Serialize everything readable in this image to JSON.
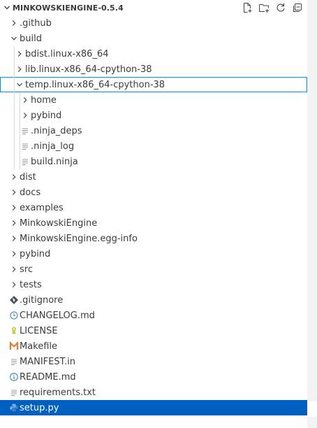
{
  "header": {
    "title": "MINKOWSKIENGINE-0.5.4",
    "actions": [
      {
        "name": "new-file-icon"
      },
      {
        "name": "new-folder-icon"
      },
      {
        "name": "refresh-icon"
      },
      {
        "name": "collapse-all-icon"
      }
    ]
  },
  "tree": [
    {
      "label": ".github",
      "depth": 0,
      "kind": "folder",
      "expanded": false
    },
    {
      "label": "build",
      "depth": 0,
      "kind": "folder",
      "expanded": true
    },
    {
      "label": "bdist.linux-x86_64",
      "depth": 1,
      "kind": "folder",
      "expanded": false
    },
    {
      "label": "lib.linux-x86_64-cpython-38",
      "depth": 1,
      "kind": "folder",
      "expanded": false
    },
    {
      "label": "temp.linux-x86_64-cpython-38",
      "depth": 1,
      "kind": "folder",
      "expanded": true,
      "focused": true
    },
    {
      "label": "home",
      "depth": 2,
      "kind": "folder",
      "expanded": false
    },
    {
      "label": "pybind",
      "depth": 2,
      "kind": "folder",
      "expanded": false
    },
    {
      "label": ".ninja_deps",
      "depth": 2,
      "kind": "file",
      "icon": "text-file-icon"
    },
    {
      "label": ".ninja_log",
      "depth": 2,
      "kind": "file",
      "icon": "text-file-icon"
    },
    {
      "label": "build.ninja",
      "depth": 2,
      "kind": "file",
      "icon": "text-file-icon"
    },
    {
      "label": "dist",
      "depth": 0,
      "kind": "folder",
      "expanded": false
    },
    {
      "label": "docs",
      "depth": 0,
      "kind": "folder",
      "expanded": false
    },
    {
      "label": "examples",
      "depth": 0,
      "kind": "folder",
      "expanded": false
    },
    {
      "label": "MinkowskiEngine",
      "depth": 0,
      "kind": "folder",
      "expanded": false
    },
    {
      "label": "MinkowskiEngine.egg-info",
      "depth": 0,
      "kind": "folder",
      "expanded": false
    },
    {
      "label": "pybind",
      "depth": 0,
      "kind": "folder",
      "expanded": false
    },
    {
      "label": "src",
      "depth": 0,
      "kind": "folder",
      "expanded": false
    },
    {
      "label": "tests",
      "depth": 0,
      "kind": "folder",
      "expanded": false
    },
    {
      "label": ".gitignore",
      "depth": 0,
      "kind": "file",
      "icon": "git-icon"
    },
    {
      "label": "CHANGELOG.md",
      "depth": 0,
      "kind": "file",
      "icon": "changelog-icon"
    },
    {
      "label": "LICENSE",
      "depth": 0,
      "kind": "file",
      "icon": "license-icon"
    },
    {
      "label": "Makefile",
      "depth": 0,
      "kind": "file",
      "icon": "makefile-icon"
    },
    {
      "label": "MANIFEST.in",
      "depth": 0,
      "kind": "file",
      "icon": "text-file-icon"
    },
    {
      "label": "README.md",
      "depth": 0,
      "kind": "file",
      "icon": "info-icon"
    },
    {
      "label": "requirements.txt",
      "depth": 0,
      "kind": "file",
      "icon": "text-file-icon"
    },
    {
      "label": "setup.py",
      "depth": 0,
      "kind": "file",
      "icon": "python-icon",
      "selected": true
    }
  ],
  "colors": {
    "selection": "#0060c0",
    "focus_outline": "#0090f1",
    "git": "#41535b",
    "changelog": "#519aba",
    "license": "#cbcb41",
    "makefile": "#e37933",
    "info": "#519aba",
    "python": "#75aeea"
  }
}
